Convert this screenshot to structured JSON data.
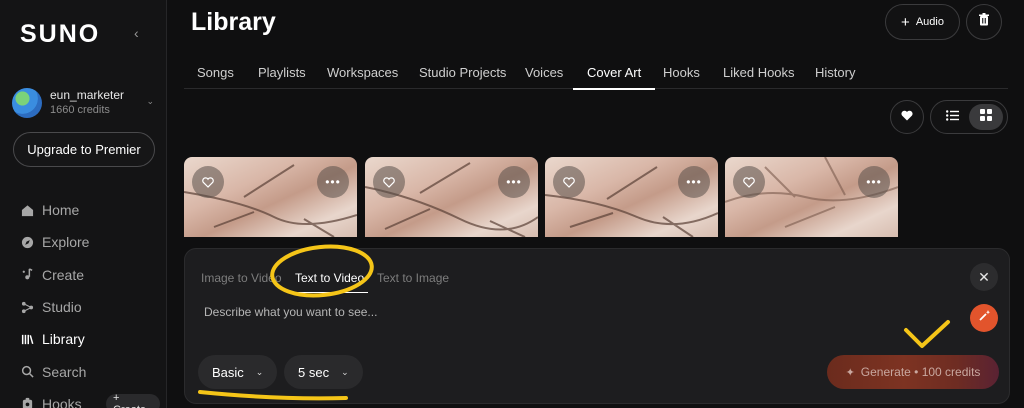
{
  "sidebar": {
    "logo": "SUNO",
    "user": {
      "name": "eun_marketer",
      "credits": "1660 credits"
    },
    "upgrade_label": "Upgrade to Premier",
    "nav": [
      {
        "label": "Home",
        "icon": "home-icon"
      },
      {
        "label": "Explore",
        "icon": "compass-icon"
      },
      {
        "label": "Create",
        "icon": "music-note-icon"
      },
      {
        "label": "Studio",
        "icon": "nodes-icon"
      },
      {
        "label": "Library",
        "icon": "library-icon"
      },
      {
        "label": "Search",
        "icon": "search-icon"
      },
      {
        "label": "Hooks",
        "icon": "hook-icon"
      }
    ],
    "hooks_create_label": "+ Create"
  },
  "header": {
    "title": "Library",
    "audio_button": "Audio",
    "tabs": [
      "Songs",
      "Playlists",
      "Workspaces",
      "Studio Projects",
      "Voices",
      "Cover Art",
      "Hooks",
      "Liked Hooks",
      "History"
    ],
    "active_tab": "Cover Art"
  },
  "cards": [
    {
      "like_icon": "heart-outline-icon",
      "more_icon": "more-horizontal-icon"
    },
    {
      "like_icon": "heart-outline-icon",
      "more_icon": "more-horizontal-icon"
    },
    {
      "like_icon": "heart-outline-icon",
      "more_icon": "more-horizontal-icon"
    },
    {
      "like_icon": "heart-outline-icon",
      "more_icon": "more-horizontal-icon"
    }
  ],
  "generator": {
    "tabs": [
      "Image to Video",
      "Text to Video",
      "Text to Image"
    ],
    "active_tab": "Text to Video",
    "prompt_placeholder": "Describe what you want to see...",
    "mode": "Basic",
    "duration": "5 sec",
    "generate_label": "Generate • 100 credits"
  },
  "colors": {
    "background": "#0f0f10",
    "panel": "#1d1d1f",
    "accent": "#e2542c",
    "annotation": "#f5c518"
  }
}
